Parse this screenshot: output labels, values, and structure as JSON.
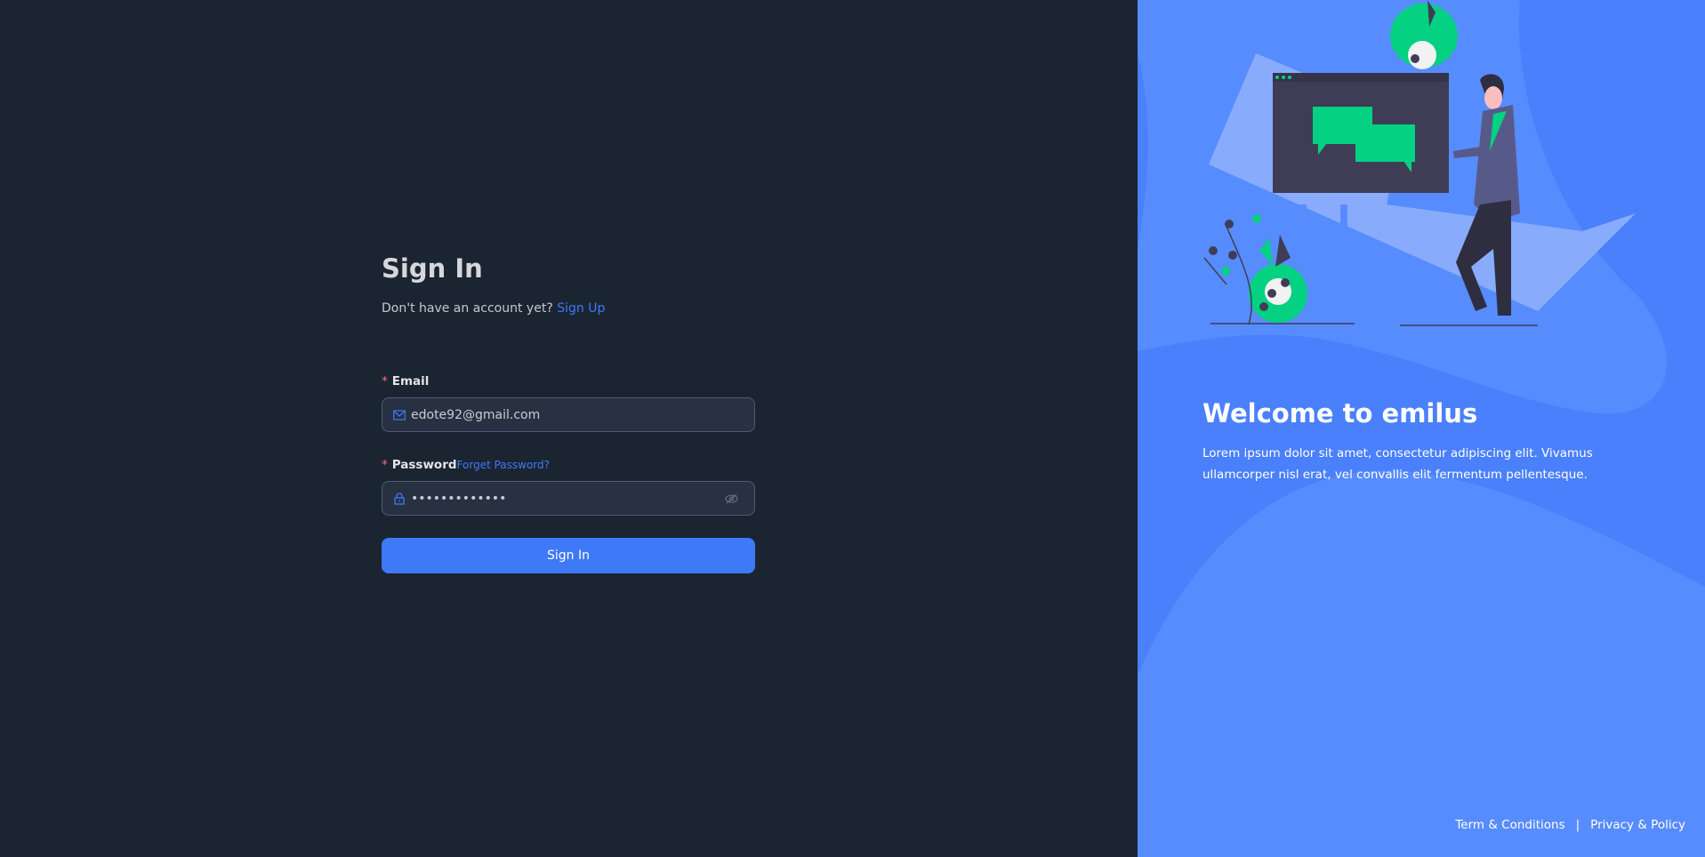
{
  "signin": {
    "title": "Sign In",
    "no_account": "Don't have an account yet?",
    "signup_link": "Sign Up",
    "email_label": "Email",
    "email_value": "edote92@gmail.com",
    "password_label": "Password",
    "forgot_link": "Forget Password?",
    "password_value": "•••••••••••••",
    "required_mark": "*",
    "submit": "Sign In"
  },
  "promo": {
    "title": "Welcome to emilus",
    "description": "Lorem ipsum dolor sit amet, consectetur adipiscing elit. Vivamus ullamcorper nisl erat, vel convallis elit fermentum pellentesque."
  },
  "footer": {
    "terms": "Term & Conditions",
    "separator": "|",
    "privacy": "Privacy & Policy"
  },
  "colors": {
    "accent": "#3e79f7",
    "left_bg": "#1b2531",
    "right_bg": "#4a80fb",
    "illustration_green": "#04d182"
  }
}
